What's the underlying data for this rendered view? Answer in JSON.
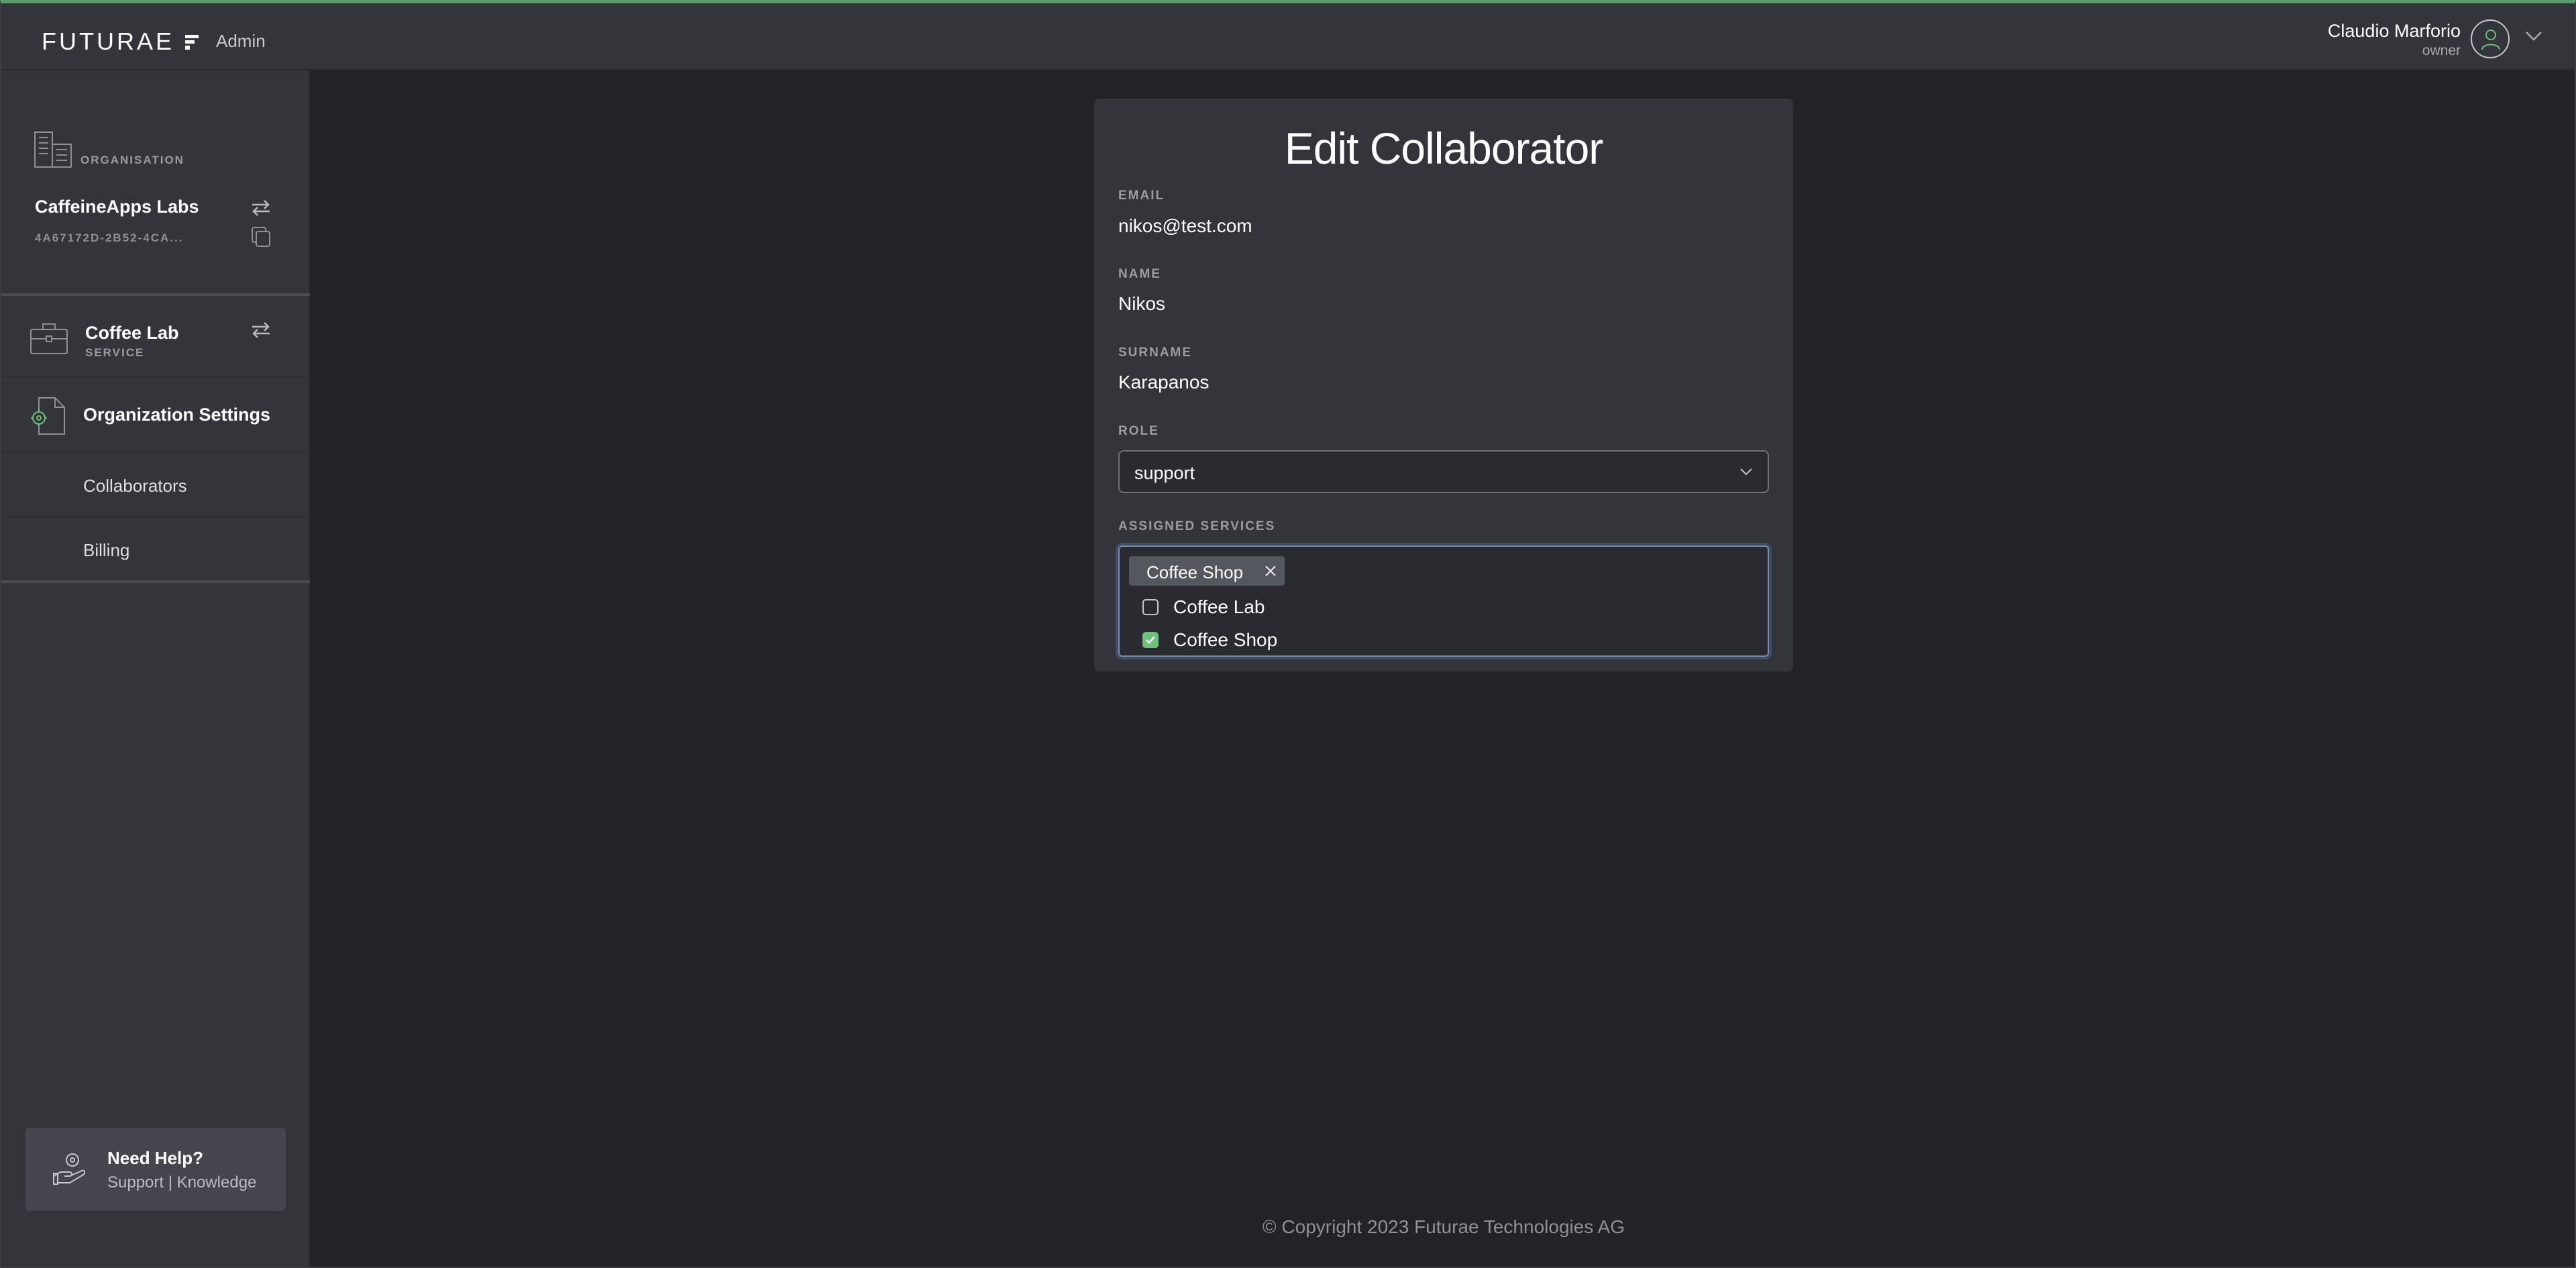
{
  "header": {
    "logo_text": "FUTURAE",
    "app_name": "Admin",
    "user_name": "Claudio Marforio",
    "user_role": "owner"
  },
  "sidebar": {
    "organisation_label": "ORGANISATION",
    "organisation_name": "CaffeineApps Labs",
    "organisation_id": "4A67172D-2B52-4CA...",
    "service_name": "Coffee Lab",
    "service_label": "SERVICE",
    "settings_label": "Organization Settings",
    "items": [
      {
        "label": "Collaborators"
      },
      {
        "label": "Billing"
      }
    ],
    "help_title": "Need Help?",
    "help_support": "Support",
    "help_sep": "|",
    "help_knowledge": "Knowledge"
  },
  "form": {
    "title": "Edit Collaborator",
    "email_label": "EMAIL",
    "email_value": "nikos@test.com",
    "name_label": "NAME",
    "name_value": "Nikos",
    "surname_label": "SURNAME",
    "surname_value": "Karapanos",
    "role_label": "ROLE",
    "role_value": "support",
    "services_label": "ASSIGNED SERVICES",
    "selected_tag": "Coffee Shop",
    "options": [
      {
        "label": "Coffee Lab",
        "checked": false
      },
      {
        "label": "Coffee Shop",
        "checked": true
      }
    ]
  },
  "footer": {
    "copyright": "© Copyright 2023 Futurae Technologies AG"
  },
  "colors": {
    "accent": "#6fbf7e",
    "background": "#222326",
    "panel": "#34353b"
  },
  "icons": [
    "building-icon",
    "swap-icon",
    "copy-icon",
    "briefcase-icon",
    "settings-doc-icon",
    "help-hand-icon",
    "user-avatar-icon",
    "chevron-down-icon",
    "close-icon",
    "check-icon"
  ]
}
